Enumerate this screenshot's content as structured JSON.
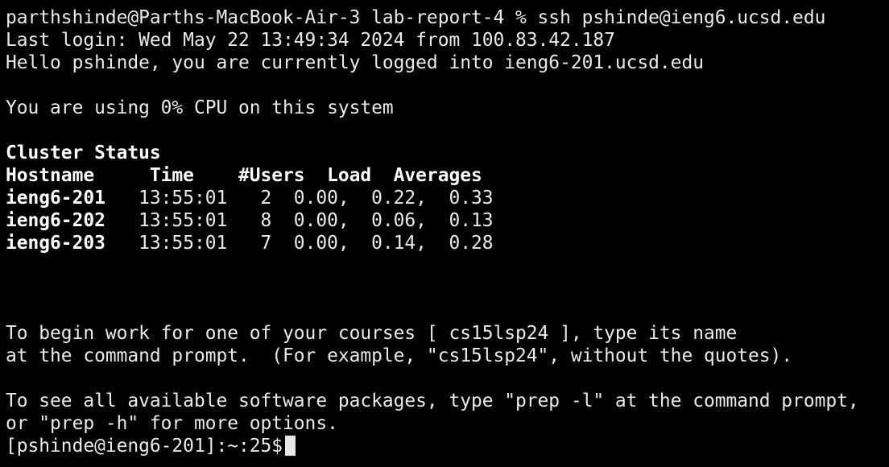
{
  "terminal": {
    "lines": [
      {
        "text": "parthshinde@Parths-MacBook-Air-3 lab-report-4 % ssh pshinde@ieng6.ucsd.edu",
        "bold": false
      },
      {
        "text": "Last login: Wed May 22 13:49:34 2024 from 100.83.42.187",
        "bold": false
      },
      {
        "text": "Hello pshinde, you are currently logged into ieng6-201.ucsd.edu",
        "bold": false
      },
      {
        "text": "",
        "bold": false
      },
      {
        "text": "You are using 0% CPU on this system",
        "bold": false
      },
      {
        "text": "",
        "bold": false
      },
      {
        "text": "Cluster Status",
        "bold": true
      },
      {
        "text": "Hostname     Time    #Users  Load  Averages",
        "bold": true
      },
      {
        "text": "ieng6-201   13:55:01   2  0.00,  0.22,  0.33",
        "bold": false,
        "boldPrefix": "ieng6-201"
      },
      {
        "text": "ieng6-202   13:55:01   8  0.00,  0.06,  0.13",
        "bold": false,
        "boldPrefix": "ieng6-202"
      },
      {
        "text": "ieng6-203   13:55:01   7  0.00,  0.14,  0.28",
        "bold": false,
        "boldPrefix": "ieng6-203"
      },
      {
        "text": "",
        "bold": false
      },
      {
        "text": "",
        "bold": false
      },
      {
        "text": "",
        "bold": false
      },
      {
        "text": "To begin work for one of your courses [ cs15lsp24 ], type its name",
        "bold": false
      },
      {
        "text": "at the command prompt.  (For example, \"cs15lsp24\", without the quotes).",
        "bold": false
      },
      {
        "text": "",
        "bold": false
      },
      {
        "text": "To see all available software packages, type \"prep -l\" at the command prompt,",
        "bold": false
      },
      {
        "text": "or \"prep -h\" for more options.",
        "bold": false
      }
    ],
    "prompt": "[pshinde@ieng6-201]:~:25$",
    "input_value": ""
  },
  "colors": {
    "background": "#000000",
    "text": "#eaeaea",
    "bold_text": "#ffffff",
    "cursor": "#e6e6e6"
  }
}
